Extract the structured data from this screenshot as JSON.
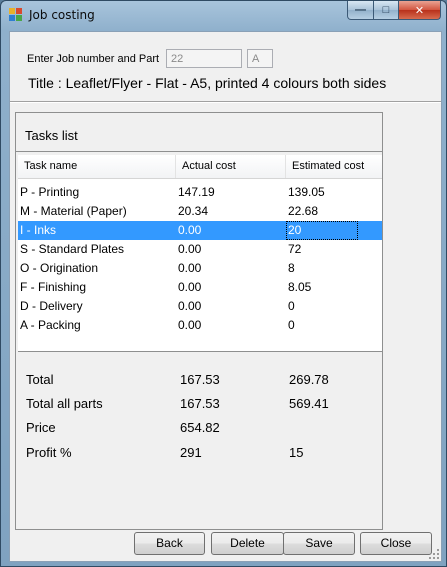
{
  "window": {
    "title": "Job costing",
    "controls": {
      "minimize": "—",
      "maximize": "□",
      "close": "✕"
    }
  },
  "job": {
    "label": "Enter Job number and Part",
    "job_number": "22",
    "part": "A",
    "title_line": "Title : Leaflet/Flyer - Flat - A5, printed 4 colours both sides"
  },
  "tasks": {
    "panel_title": "Tasks list",
    "columns": [
      "Task name",
      "Actual cost",
      "Estimated cost"
    ],
    "rows": [
      {
        "name": "P - Printing",
        "actual": "147.19",
        "estimated": "139.05"
      },
      {
        "name": "M - Material (Paper)",
        "actual": "20.34",
        "estimated": "22.68"
      },
      {
        "name": "I - Inks",
        "actual": "0.00",
        "estimated": "20",
        "selected": true
      },
      {
        "name": "S - Standard Plates",
        "actual": "0.00",
        "estimated": "72"
      },
      {
        "name": "O - Origination",
        "actual": "0.00",
        "estimated": "8"
      },
      {
        "name": "F - Finishing",
        "actual": "0.00",
        "estimated": "8.05"
      },
      {
        "name": "D - Delivery",
        "actual": "0.00",
        "estimated": "0"
      },
      {
        "name": "A - Packing",
        "actual": "0.00",
        "estimated": "0"
      }
    ]
  },
  "totals": [
    {
      "label": "Total",
      "actual": "167.53",
      "estimated": "269.78"
    },
    {
      "label": "Total all parts",
      "actual": "167.53",
      "estimated": "569.41"
    },
    {
      "label": "Price",
      "actual": "654.82",
      "estimated": ""
    },
    {
      "label": "Profit %",
      "actual": "291",
      "estimated": "15"
    }
  ],
  "buttons": {
    "back": "Back",
    "delete": "Delete",
    "save": "Save",
    "close": "Close"
  },
  "colors": {
    "selection": "#3399ff",
    "window_frame": "#8fb0cc",
    "close_button": "#c7432b"
  }
}
